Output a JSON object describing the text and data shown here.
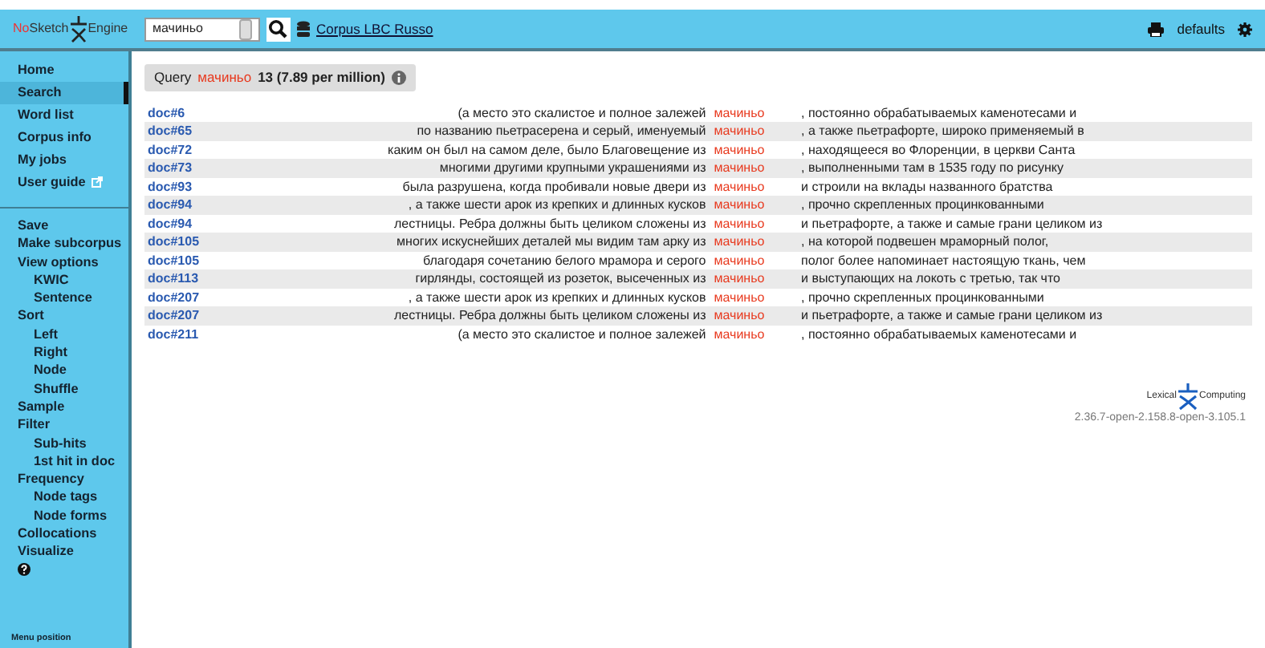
{
  "header": {
    "logo": {
      "prefix": "No",
      "middle": "Sketch",
      "suffix": "Engine"
    },
    "search": {
      "value": "мачиньо"
    },
    "corpus_link": "Corpus LBC Russo",
    "user_menu": "defaults"
  },
  "sidebar": {
    "groups": [
      {
        "items": [
          {
            "label": "Home",
            "selected": false
          },
          {
            "label": "Search",
            "selected": true
          },
          {
            "label": "Word list",
            "selected": false
          },
          {
            "label": "Corpus info",
            "selected": false
          },
          {
            "label": "My jobs",
            "selected": false
          },
          {
            "label": "User guide",
            "selected": false,
            "external": true
          }
        ]
      },
      {
        "items": [
          {
            "label": "Save",
            "selected": false
          },
          {
            "label": "Make subcorpus",
            "selected": false
          },
          {
            "label": "View options",
            "selected": false,
            "children": [
              {
                "label": "KWIC"
              },
              {
                "label": "Sentence"
              }
            ]
          },
          {
            "label": "Sort",
            "selected": false,
            "children": [
              {
                "label": "Left"
              },
              {
                "label": "Right"
              },
              {
                "label": "Node"
              },
              {
                "label": "Shuffle"
              }
            ]
          },
          {
            "label": "Sample",
            "selected": false
          },
          {
            "label": "Filter",
            "selected": false,
            "children": [
              {
                "label": "Sub-hits"
              },
              {
                "label": "1st hit in doc"
              }
            ]
          },
          {
            "label": "Frequency",
            "selected": false,
            "children": [
              {
                "label": "Node tags"
              },
              {
                "label": "Node forms"
              }
            ]
          },
          {
            "label": "Collocations",
            "selected": false
          },
          {
            "label": "Visualize",
            "selected": false
          }
        ]
      }
    ],
    "menu_position": "Menu position"
  },
  "query": {
    "label": "Query",
    "term": "мачиньо",
    "count": "13 (7.89 per million)"
  },
  "rows": [
    {
      "doc": "doc#6",
      "left": "(а место это скалистое и полное залежей",
      "kwic": "мачиньо",
      "right": ", постоянно обрабатываемых каменотесами и"
    },
    {
      "doc": "doc#65",
      "left": "по названию пьетрасерена и серый, именуемый",
      "kwic": "мачиньо",
      "right": ", а также пьетрафорте, широко применяемый в"
    },
    {
      "doc": "doc#72",
      "left": "каким он был на самом деле, было Благовещение из",
      "kwic": "мачиньо",
      "right": ", находящееся во Флоренции, в церкви Санта"
    },
    {
      "doc": "doc#73",
      "left": "многими другими крупными украшениями из",
      "kwic": "мачиньо",
      "right": ", выполненными там в 1535 году по рисунку"
    },
    {
      "doc": "doc#93",
      "left": "была разрушена, когда пробивали новые двери из",
      "kwic": "мачиньо",
      "right": "и строили на вклады названного братства"
    },
    {
      "doc": "doc#94",
      "left": ", а также шести арок из крепких и длинных кусков",
      "kwic": "мачиньо",
      "right": ", прочно скрепленных процинкованными"
    },
    {
      "doc": "doc#94",
      "left": "лестницы. Ребра должны быть целиком сложены из",
      "kwic": "мачиньо",
      "right": "и пьетрафорте, а также и самые грани целиком из"
    },
    {
      "doc": "doc#105",
      "left": "многих искуснейших деталей мы видим там арку из",
      "kwic": "мачиньо",
      "right": ", на которой подвешен мраморный полог,"
    },
    {
      "doc": "doc#105",
      "left": "благодаря сочетанию белого мрамора и серого",
      "kwic": "мачиньо",
      "right": "полог более напоминает настоящую ткань, чем"
    },
    {
      "doc": "doc#113",
      "left": "гирлянды, состоящей из розеток, высеченных из",
      "kwic": "мачиньо",
      "right": "и выступающих на локоть с третью, так что"
    },
    {
      "doc": "doc#207",
      "left": ", а также шести арок из крепких и длинных кусков",
      "kwic": "мачиньо",
      "right": ", прочно скрепленных процинкованными"
    },
    {
      "doc": "doc#207",
      "left": "лестницы. Ребра должны быть целиком сложены из",
      "kwic": "мачиньо",
      "right": "и пьетрафорте, а также и самые грани целиком из"
    },
    {
      "doc": "doc#211",
      "left": "(а место это скалистое и полное залежей",
      "kwic": "мачиньо",
      "right": ", постоянно обрабатываемых каменотесами и"
    }
  ],
  "footer": {
    "brand_left": "Lexical",
    "brand_right": "Computing",
    "version": "2.36.7-open-2.158.8-open-3.105.1"
  }
}
